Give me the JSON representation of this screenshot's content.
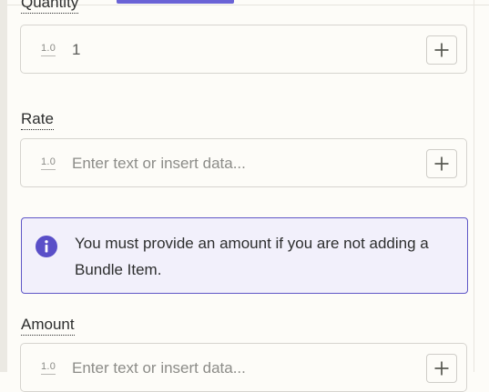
{
  "quantity_field": {
    "label": "Quantity",
    "type_badge": "1.0",
    "value": "1",
    "insert_button_icon": "plus-icon"
  },
  "rate_field": {
    "label": "Rate",
    "type_badge": "1.0",
    "placeholder": "Enter text or insert data...",
    "insert_button_icon": "plus-icon"
  },
  "notice": {
    "icon": "info-icon",
    "message": "You must provide an amount if you are not adding a Bundle Item.",
    "accent_color": "#5f57c7",
    "background_color": "#f2f0fb"
  },
  "amount_field": {
    "label": "Amount",
    "type_badge": "1.0",
    "placeholder": "Enter text or insert data...",
    "insert_button_icon": "plus-icon"
  },
  "theme": {
    "accent": "#6a63d6",
    "page_background": "#fdfcf8"
  }
}
